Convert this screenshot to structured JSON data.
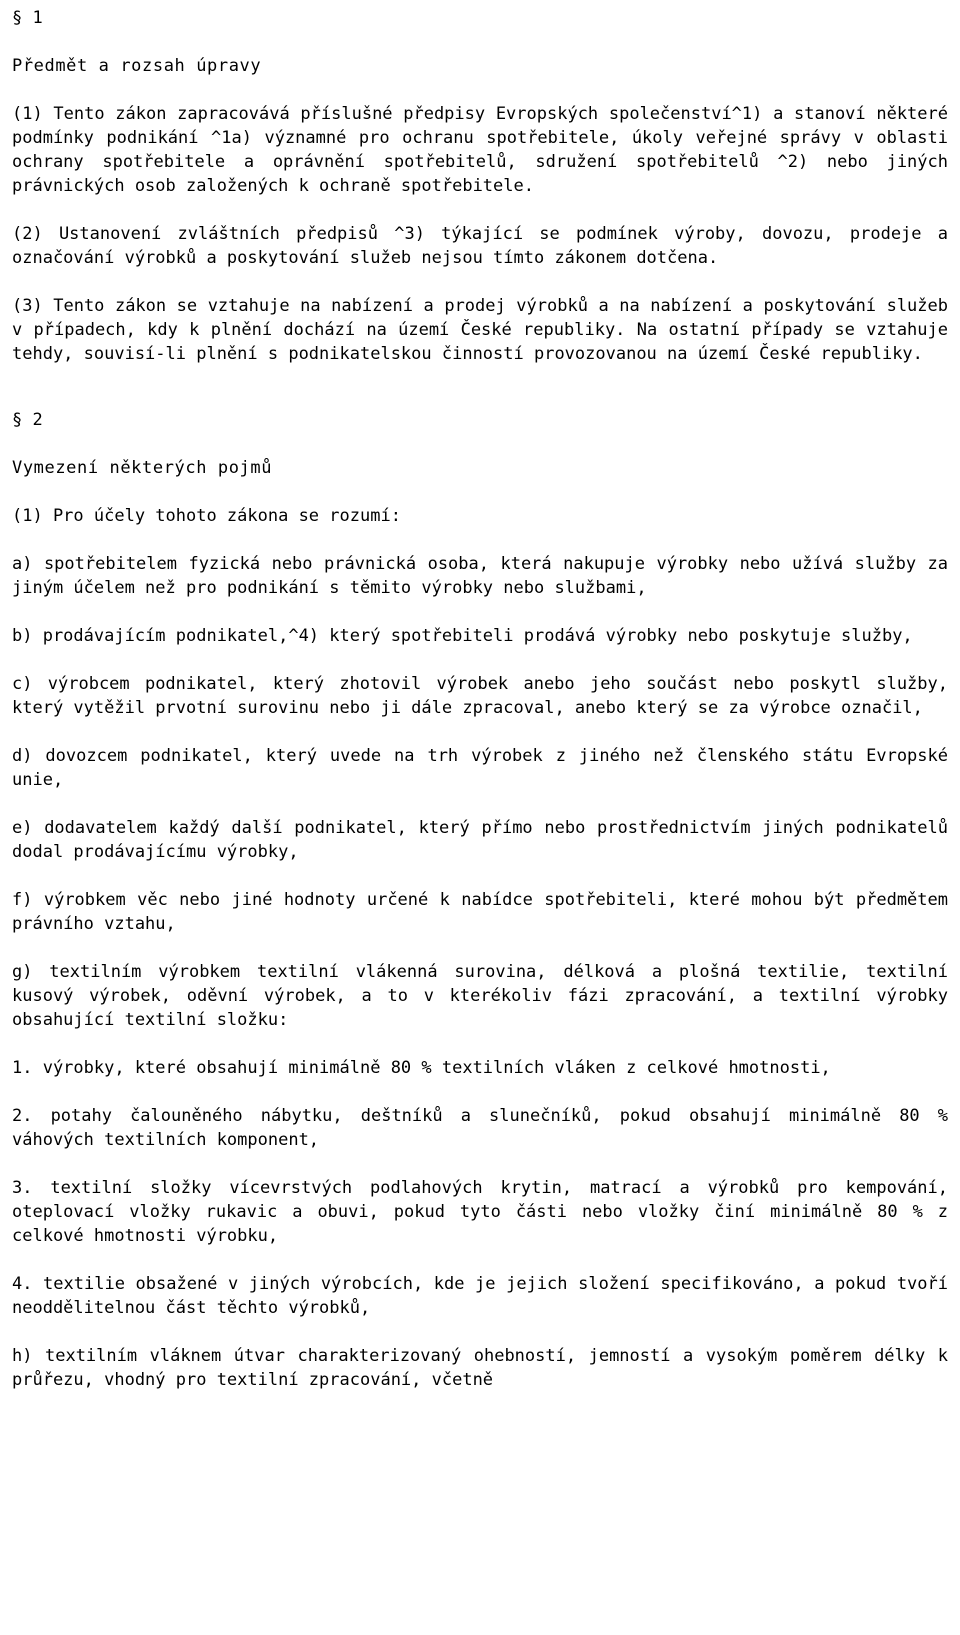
{
  "document": {
    "language": "cs",
    "font_style": "monospace",
    "text_align": "justify",
    "background_color": "#ffffff",
    "text_color": "#000000",
    "sections": [
      {
        "mark": "§ 1",
        "title": "Předmět a rozsah úpravy",
        "paragraphs": [
          "(1)  Tento  zákon  zapracovává  příslušné  předpisy  Evropských společenství^1)  a stanoví některé podmínky podnikání ^1a) významné pro ochranu  spotřebitele,  úkoly  veřejné  správy v oblasti ochrany spotřebitele  a  oprávnění spotřebitelů, sdružení spotřebitelů ^2) nebo jiných právnických osob založených k ochraně spotřebitele.",
          "(2)  Ustanovení  zvláštních  předpisů  ^3) týkající se podmínek výroby, dovozu,  prodeje a označování výrobků a poskytování služeb nejsou tímto zákonem dotčena.",
          "(3)  Tento zákon se vztahuje na nabízení a prodej výrobků a na nabízení a  poskytování  služeb v případech, kdy k plnění dochází na území České republiky.  Na  ostatní  případy se vztahuje tehdy, souvisí-li plnění s podnikatelskou činností provozovanou na území České republiky."
        ]
      },
      {
        "mark": "§ 2",
        "title": "Vymezení některých pojmů",
        "paragraphs": [
          "(1) Pro účely tohoto zákona se rozumí:",
          "a)  spotřebitelem  fyzická nebo právnická osoba, která nakupuje výrobky nebo  užívá  služby  za jiným účelem než pro podnikání s těmito výrobky nebo službami,",
          "b)  prodávajícím podnikatel,^4) který spotřebiteli prodává výrobky nebo poskytuje služby,",
          "c)  výrobcem podnikatel, který zhotovil výrobek anebo jeho součást nebo poskytl  služby, který vytěžil prvotní surovinu nebo ji dále zpracoval, anebo který se za výrobce označil,",
          "d)  dovozcem  podnikatel,  který  uvede  na  trh  výrobek  z jiného než členského státu Evropské unie,",
          "e) dodavatelem každý další podnikatel, který přímo nebo prostřednictvím jiných podnikatelů dodal prodávajícímu výrobky,",
          "f)  výrobkem věc nebo jiné hodnoty určené k nabídce spotřebiteli, které mohou být předmětem právního vztahu,",
          "g)  textilním  výrobkem  textilní  vlákenná  surovina, délková a plošná textilie,  textilní  kusový  výrobek, oděvní výrobek, a to v kterékoliv fázi zpracování, a textilní výrobky obsahující textilní složku:",
          "1.  výrobky,  které obsahují minimálně 80 % textilních vláken z celkové hmotnosti,",
          "2.  potahy  čalouněného  nábytku, deštníků a slunečníků, pokud obsahují minimálně 80 % váhových textilních komponent,",
          "3.  textilní  složky vícevrstvých podlahových krytin, matrací a výrobků pro kempování, oteplovací vložky rukavic a obuvi, pokud tyto části nebo vložky činí minimálně 80 % z celkové hmotnosti výrobku,",
          "4.  textilie  obsažené  v  jiných  výrobcích,  kde  je  jejich  složení specifikováno, a pokud tvoří neoddělitelnou část těchto výrobků,",
          "h)  textilním  vláknem  útvar  charakterizovaný  ohebností,  jemností a vysokým poměrem délky k průřezu, vhodný pro textilní zpracování, včetně"
        ]
      }
    ]
  }
}
